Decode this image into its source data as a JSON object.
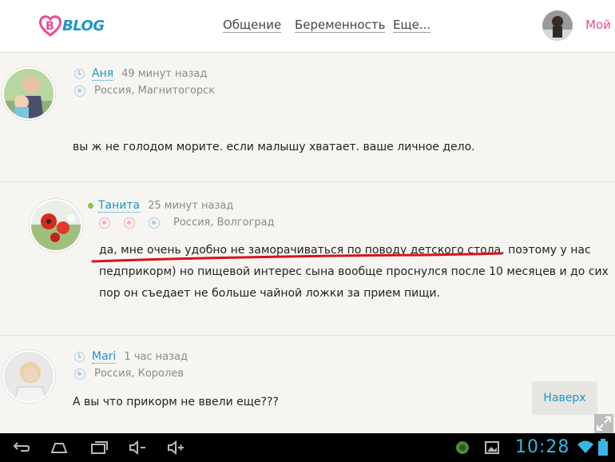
{
  "header": {
    "logo_text": "BLOG",
    "nav": [
      "Общение",
      "Беременность",
      "Еще..."
    ],
    "user_label": "Мой дневник"
  },
  "comments": [
    {
      "author": "Аня",
      "time": "49 минут назад",
      "location": "Россия, Магнитогорск",
      "text": "вы ж не голодом морите. если малышу хватает. ваше личное дело."
    },
    {
      "author": "Танита",
      "time": "25 минут назад",
      "location": "Россия, Волгоград",
      "text_line1_underlined": "да, мне очень удобно не заморачиваться по поводу детского стола,",
      "text_line1_rest": " поэтому у нас",
      "text_line2": "педприкорм) но пищевой интерес сына вообще проснулся после 10 месяцев и до сих",
      "text_line3": "пор он съедает не больше чайной ложки за прием пищи."
    },
    {
      "author": "Mari",
      "time": "1 час назад",
      "location": "Россия, Королев",
      "text": "А вы что прикорм не ввели еще???"
    }
  ],
  "back_to_top": "Наверх",
  "system_bar": {
    "clock": "10:28"
  },
  "colors": {
    "accent_blue": "#1d96c8",
    "brand_pink": "#e84b97",
    "annotation_red": "#d9121b"
  }
}
